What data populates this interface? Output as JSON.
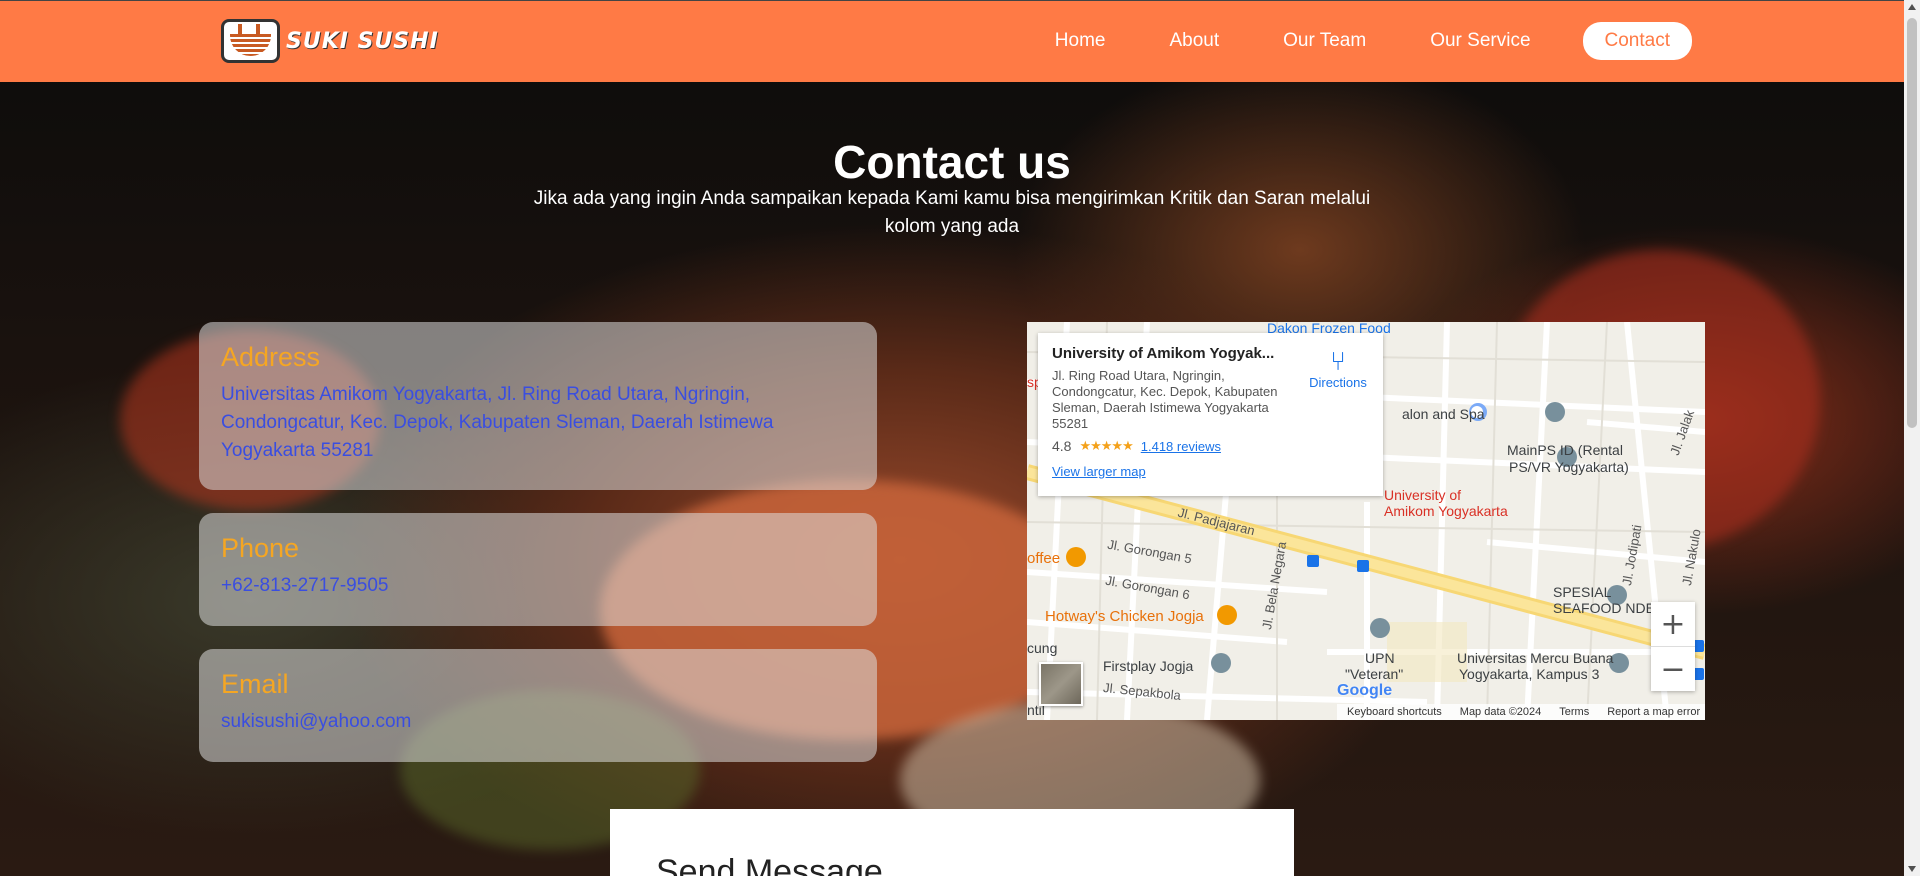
{
  "brand": {
    "name": "SUKI SUSHI",
    "logo_icon": "noodle-bowl-icon"
  },
  "nav": {
    "items": [
      {
        "label": "Home"
      },
      {
        "label": "About"
      },
      {
        "label": "Our Team"
      },
      {
        "label": "Our Service"
      },
      {
        "label": "Contact",
        "active": true
      }
    ]
  },
  "hero": {
    "title": "Contact us",
    "subtitle": "Jika ada yang ingin Anda sampaikan kepada Kami kamu bisa mengirimkan Kritik dan Saran melalui kolom yang ada"
  },
  "contact": {
    "address": {
      "title": "Address",
      "value": "Universitas Amikom Yogyakarta, Jl. Ring Road Utara, Ngringin, Condongcatur, Kec. Depok, Kabupaten Sleman, Daerah Istimewa Yogyakarta 55281"
    },
    "phone": {
      "title": "Phone",
      "value": "+62-813-2717-9505"
    },
    "email": {
      "title": "Email",
      "value": "sukisushi@yahoo.com"
    }
  },
  "map": {
    "place_name": "University of Amikom Yogyak...",
    "address": "Jl. Ring Road Utara, Ngringin, Condongcatur, Kec. Depok, Kabupaten Sleman, Daerah Istimewa Yogyakarta 55281",
    "rating": "4.8",
    "stars": "★★★★★",
    "reviews": "1.418 reviews",
    "directions": "Directions",
    "larger_map": "View larger map",
    "labels": {
      "dakon": "Dakon Frozen Food",
      "salon": "alon and Spa",
      "mainps1": "MainPS ID (Rental",
      "mainps2": "PS/VR Yogyakarta)",
      "univ1": "University of",
      "univ2": "Amikom Yogyakarta",
      "padjajaran": "Jl. Padjajaran",
      "gorongan5": "Jl. Gorongan 5",
      "gorongan6": "Jl. Gorongan 6",
      "coffee": "offee",
      "hotway": "Hotway's Chicken Jogja",
      "spesial": "SPESIAL",
      "seafood": "SEAFOOD NDESO",
      "upn1": "UPN",
      "upn2": "\"Veteran\"",
      "firstplay": "Firstplay Jogja",
      "sepakbola": "Jl. Sepakbola",
      "mercu1": "Universitas Mercu Buana",
      "mercu2": "Yogyakarta, Kampus 3",
      "belanegara": "Jl. Bela Negara",
      "jodipati": "Jl. Jodipati",
      "jalak": "Jl. Jalak",
      "nakulo": "Jl. Nakulo",
      "cung": "cung",
      "sp": "sp",
      "ntil": "ntil"
    },
    "zoom_in": "+",
    "zoom_out": "−",
    "logo": "Google",
    "footer": {
      "shortcuts": "Keyboard shortcuts",
      "data": "Map data ©2024",
      "terms": "Terms",
      "report": "Report a map error"
    }
  },
  "send": {
    "title": "Send Message"
  },
  "colors": {
    "accent": "#ff7a45",
    "card_title": "#f5a623",
    "card_text": "#3a4ee0"
  }
}
